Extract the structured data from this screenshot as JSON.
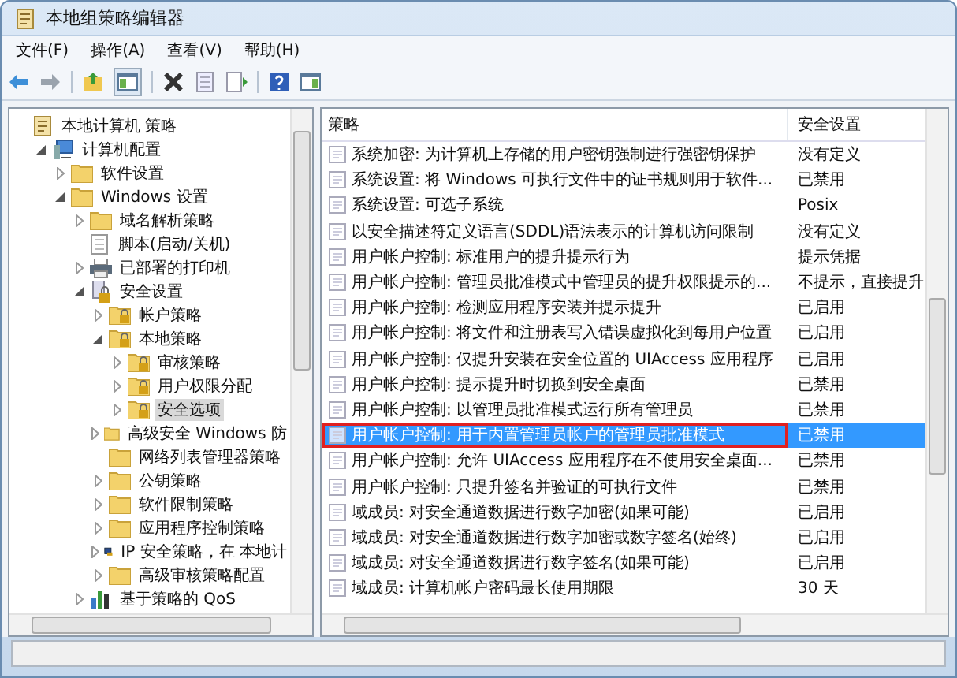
{
  "window": {
    "title": "本地组策略编辑器"
  },
  "menu": [
    "文件(F)",
    "操作(A)",
    "查看(V)",
    "帮助(H)"
  ],
  "toolbar": [
    {
      "kind": "back"
    },
    {
      "kind": "forward"
    },
    {
      "kind": "sep"
    },
    {
      "kind": "up"
    },
    {
      "kind": "tree"
    },
    {
      "kind": "sep"
    },
    {
      "kind": "delete"
    },
    {
      "kind": "properties"
    },
    {
      "kind": "export"
    },
    {
      "kind": "sep"
    },
    {
      "kind": "help"
    },
    {
      "kind": "actionpane"
    }
  ],
  "tree": {
    "items": [
      {
        "label": "本地计算机 策略",
        "kind": "doc",
        "expandable": false,
        "selected": false,
        "children": [
          {
            "label": "计算机配置",
            "kind": "computer",
            "expandable": true,
            "expanded": true,
            "selected": false,
            "children": [
              {
                "label": "软件设置",
                "kind": "folder",
                "expandable": true,
                "expanded": false,
                "selected": false
              },
              {
                "label": "Windows 设置",
                "kind": "folder",
                "expandable": true,
                "expanded": true,
                "selected": false,
                "children": [
                  {
                    "label": "域名解析策略",
                    "kind": "folder",
                    "expandable": true,
                    "expanded": false,
                    "selected": false
                  },
                  {
                    "label": "脚本(启动/关机)",
                    "kind": "script",
                    "expandable": false,
                    "selected": false
                  },
                  {
                    "label": "已部署的打印机",
                    "kind": "printer",
                    "expandable": true,
                    "expanded": false,
                    "selected": false
                  },
                  {
                    "label": "安全设置",
                    "kind": "secure",
                    "expandable": true,
                    "expanded": true,
                    "selected": false,
                    "children": [
                      {
                        "label": "帐户策略",
                        "kind": "lockfolder",
                        "expandable": true,
                        "expanded": false,
                        "selected": false
                      },
                      {
                        "label": "本地策略",
                        "kind": "lockfolder",
                        "expandable": true,
                        "expanded": true,
                        "selected": false,
                        "children": [
                          {
                            "label": "审核策略",
                            "kind": "lockfolder",
                            "expandable": true,
                            "expanded": false,
                            "selected": false
                          },
                          {
                            "label": "用户权限分配",
                            "kind": "lockfolder",
                            "expandable": true,
                            "expanded": false,
                            "selected": false
                          },
                          {
                            "label": "安全选项",
                            "kind": "lockfolder",
                            "expandable": true,
                            "expanded": false,
                            "selected": true
                          }
                        ]
                      },
                      {
                        "label": "高级安全 Windows 防",
                        "kind": "folder",
                        "expandable": true,
                        "expanded": false,
                        "selected": false
                      },
                      {
                        "label": "网络列表管理器策略",
                        "kind": "folder",
                        "expandable": false,
                        "selected": false
                      },
                      {
                        "label": "公钥策略",
                        "kind": "folder",
                        "expandable": true,
                        "expanded": false,
                        "selected": false
                      },
                      {
                        "label": "软件限制策略",
                        "kind": "folder",
                        "expandable": true,
                        "expanded": false,
                        "selected": false
                      },
                      {
                        "label": "应用程序控制策略",
                        "kind": "folder",
                        "expandable": true,
                        "expanded": false,
                        "selected": false
                      },
                      {
                        "label": "IP 安全策略，在 本地计",
                        "kind": "ip",
                        "expandable": true,
                        "expanded": false,
                        "selected": false
                      },
                      {
                        "label": "高级审核策略配置",
                        "kind": "folder",
                        "expandable": true,
                        "expanded": false,
                        "selected": false
                      }
                    ]
                  },
                  {
                    "label": "基于策略的 QoS",
                    "kind": "chart",
                    "expandable": true,
                    "expanded": false,
                    "selected": false
                  }
                ]
              }
            ]
          }
        ]
      }
    ]
  },
  "table": {
    "columns": [
      "策略",
      "安全设置"
    ],
    "rows": [
      {
        "policy": "系统加密: 为计算机上存储的用户密钥强制进行强密钥保护",
        "setting": "没有定义",
        "selected": false,
        "outlined": false
      },
      {
        "policy": "系统设置: 将 Windows 可执行文件中的证书规则用于软件...",
        "setting": "已禁用",
        "selected": false,
        "outlined": false
      },
      {
        "policy": "系统设置: 可选子系统",
        "setting": "Posix",
        "selected": false,
        "outlined": false
      },
      {
        "policy": "以安全描述符定义语言(SDDL)语法表示的计算机访问限制",
        "setting": "没有定义",
        "selected": false,
        "outlined": false
      },
      {
        "policy": "用户帐户控制: 标准用户的提升提示行为",
        "setting": "提示凭据",
        "selected": false,
        "outlined": false
      },
      {
        "policy": "用户帐户控制: 管理员批准模式中管理员的提升权限提示的...",
        "setting": "不提示，直接提升",
        "selected": false,
        "outlined": false
      },
      {
        "policy": "用户帐户控制: 检测应用程序安装并提示提升",
        "setting": "已启用",
        "selected": false,
        "outlined": false
      },
      {
        "policy": "用户帐户控制: 将文件和注册表写入错误虚拟化到每用户位置",
        "setting": "已启用",
        "selected": false,
        "outlined": false
      },
      {
        "policy": "用户帐户控制: 仅提升安装在安全位置的 UIAccess 应用程序",
        "setting": "已启用",
        "selected": false,
        "outlined": false
      },
      {
        "policy": "用户帐户控制: 提示提升时切换到安全桌面",
        "setting": "已禁用",
        "selected": false,
        "outlined": false
      },
      {
        "policy": "用户帐户控制: 以管理员批准模式运行所有管理员",
        "setting": "已禁用",
        "selected": false,
        "outlined": false
      },
      {
        "policy": "用户帐户控制: 用于内置管理员帐户的管理员批准模式",
        "setting": "已禁用",
        "selected": true,
        "outlined": true
      },
      {
        "policy": "用户帐户控制: 允许 UIAccess 应用程序在不使用安全桌面...",
        "setting": "已禁用",
        "selected": false,
        "outlined": false
      },
      {
        "policy": "用户帐户控制: 只提升签名并验证的可执行文件",
        "setting": "已禁用",
        "selected": false,
        "outlined": false
      },
      {
        "policy": "域成员: 对安全通道数据进行数字加密(如果可能)",
        "setting": "已启用",
        "selected": false,
        "outlined": false
      },
      {
        "policy": "域成员: 对安全通道数据进行数字加密或数字签名(始终)",
        "setting": "已启用",
        "selected": false,
        "outlined": false
      },
      {
        "policy": "域成员: 对安全通道数据进行数字签名(如果可能)",
        "setting": "已启用",
        "selected": false,
        "outlined": false
      },
      {
        "policy": "域成员: 计算机帐户密码最长使用期限",
        "setting": "30 天",
        "selected": false,
        "outlined": false
      }
    ]
  }
}
